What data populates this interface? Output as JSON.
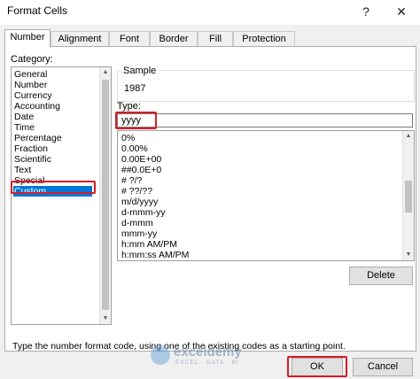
{
  "window": {
    "title": "Format Cells",
    "help": "?",
    "close": "✕"
  },
  "tabs": [
    "Number",
    "Alignment",
    "Font",
    "Border",
    "Fill",
    "Protection"
  ],
  "category": {
    "label": "Category:",
    "items": [
      "General",
      "Number",
      "Currency",
      "Accounting",
      "Date",
      "Time",
      "Percentage",
      "Fraction",
      "Scientific",
      "Text",
      "Special",
      "Custom"
    ],
    "selected": "Custom"
  },
  "sample": {
    "label": "Sample",
    "value": "1987"
  },
  "type": {
    "label": "Type:",
    "value": "yyyy",
    "formats": [
      "0%",
      "0.00%",
      "0.00E+00",
      "##0.0E+0",
      "# ?/?",
      "# ??/??",
      "m/d/yyyy",
      "d-mmm-yy",
      "d-mmm",
      "mmm-yy",
      "h:mm AM/PM",
      "h:mm:ss AM/PM"
    ]
  },
  "buttons": {
    "delete": "Delete",
    "ok": "OK",
    "cancel": "Cancel"
  },
  "hint": "Type the number format code, using one of the existing codes as a starting point.",
  "watermark": {
    "name": "exceldemy",
    "tagline": "EXCEL · DATA · BI"
  },
  "colors": {
    "highlight": "#d81b28",
    "selection": "#0078d7"
  }
}
